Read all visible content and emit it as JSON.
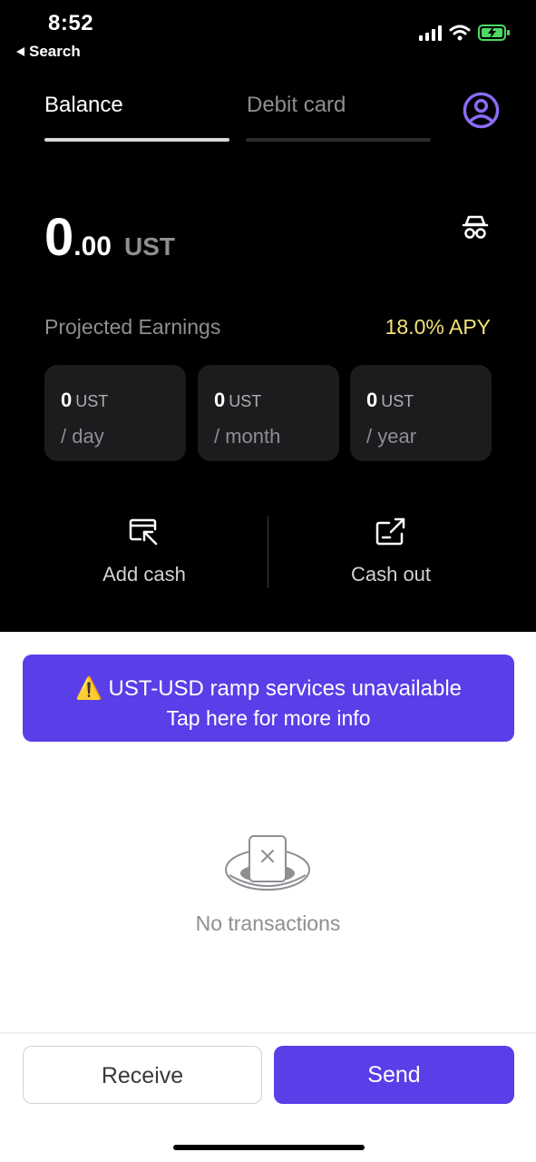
{
  "status_bar": {
    "time": "8:52",
    "back_label": "Search"
  },
  "tabs": [
    {
      "label": "Balance",
      "active": true
    },
    {
      "label": "Debit card",
      "active": false
    }
  ],
  "balance": {
    "integer": "0",
    "decimal": ".00",
    "unit": "UST"
  },
  "earnings": {
    "label": "Projected Earnings",
    "apy": "18.0% APY",
    "cards": [
      {
        "value": "0",
        "unit": "UST",
        "period": "/ day"
      },
      {
        "value": "0",
        "unit": "UST",
        "period": "/ month"
      },
      {
        "value": "0",
        "unit": "UST",
        "period": "/ year"
      }
    ]
  },
  "actions": {
    "add_cash": "Add cash",
    "cash_out": "Cash out"
  },
  "banner": {
    "line1": "⚠️ UST-USD ramp services unavailable",
    "line2": "Tap here for more info"
  },
  "empty_state": {
    "text": "No transactions"
  },
  "buttons": {
    "receive": "Receive",
    "send": "Send"
  },
  "colors": {
    "accent": "#5a3ee8",
    "apy": "#f5e17a",
    "avatar": "#8b6cf6",
    "battery": "#4cd964"
  },
  "icons": [
    "back-arrow-icon",
    "signal-icon",
    "wifi-icon",
    "battery-charging-icon",
    "profile-icon",
    "incognito-icon",
    "add-cash-icon",
    "cash-out-icon",
    "no-transactions-icon"
  ]
}
